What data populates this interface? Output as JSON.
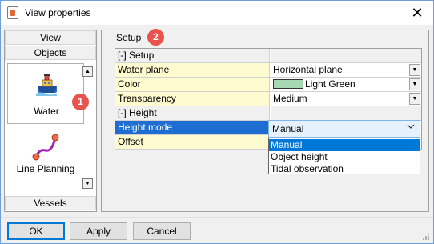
{
  "window": {
    "title": "View properties",
    "close_glyph": "✕"
  },
  "left_panel": {
    "headers": {
      "view": "View",
      "objects": "Objects",
      "vessels": "Vessels"
    },
    "items": [
      {
        "label": "Water",
        "icon": "boat-icon",
        "selected": true
      },
      {
        "label": "Line Planning",
        "icon": "line-planning-icon",
        "selected": false
      }
    ],
    "scroll_up": "▲",
    "scroll_down": "▼"
  },
  "badges": {
    "first": "1",
    "second": "2"
  },
  "right_panel": {
    "group_title": "Setup",
    "rows": [
      {
        "type": "category",
        "name": "[-] Setup",
        "value": ""
      },
      {
        "type": "property",
        "name": "Water plane",
        "value": "Horizontal plane",
        "dropdown": true
      },
      {
        "type": "property",
        "name": "Color",
        "value": "Light Green",
        "dropdown": true,
        "swatch": "#a6d9b1"
      },
      {
        "type": "property",
        "name": "Transparency",
        "value": "Medium",
        "dropdown": true
      },
      {
        "type": "category",
        "name": "[-] Height",
        "value": ""
      },
      {
        "type": "selected",
        "name": "Height mode",
        "value": "Manual"
      },
      {
        "type": "property",
        "name": "Offset",
        "value": ""
      }
    ],
    "combo": {
      "value": "Manual",
      "chevron": "⌵"
    },
    "options": [
      "Manual",
      "Object height",
      "Tidal observation"
    ],
    "active_option": "Manual"
  },
  "footer": {
    "ok": "OK",
    "apply": "Apply",
    "cancel": "Cancel"
  },
  "colors": {
    "accent": "#0078d7",
    "badge": "#e8534d",
    "selected_row": "#1e6ed1",
    "property_bg": "#fffbd0"
  }
}
